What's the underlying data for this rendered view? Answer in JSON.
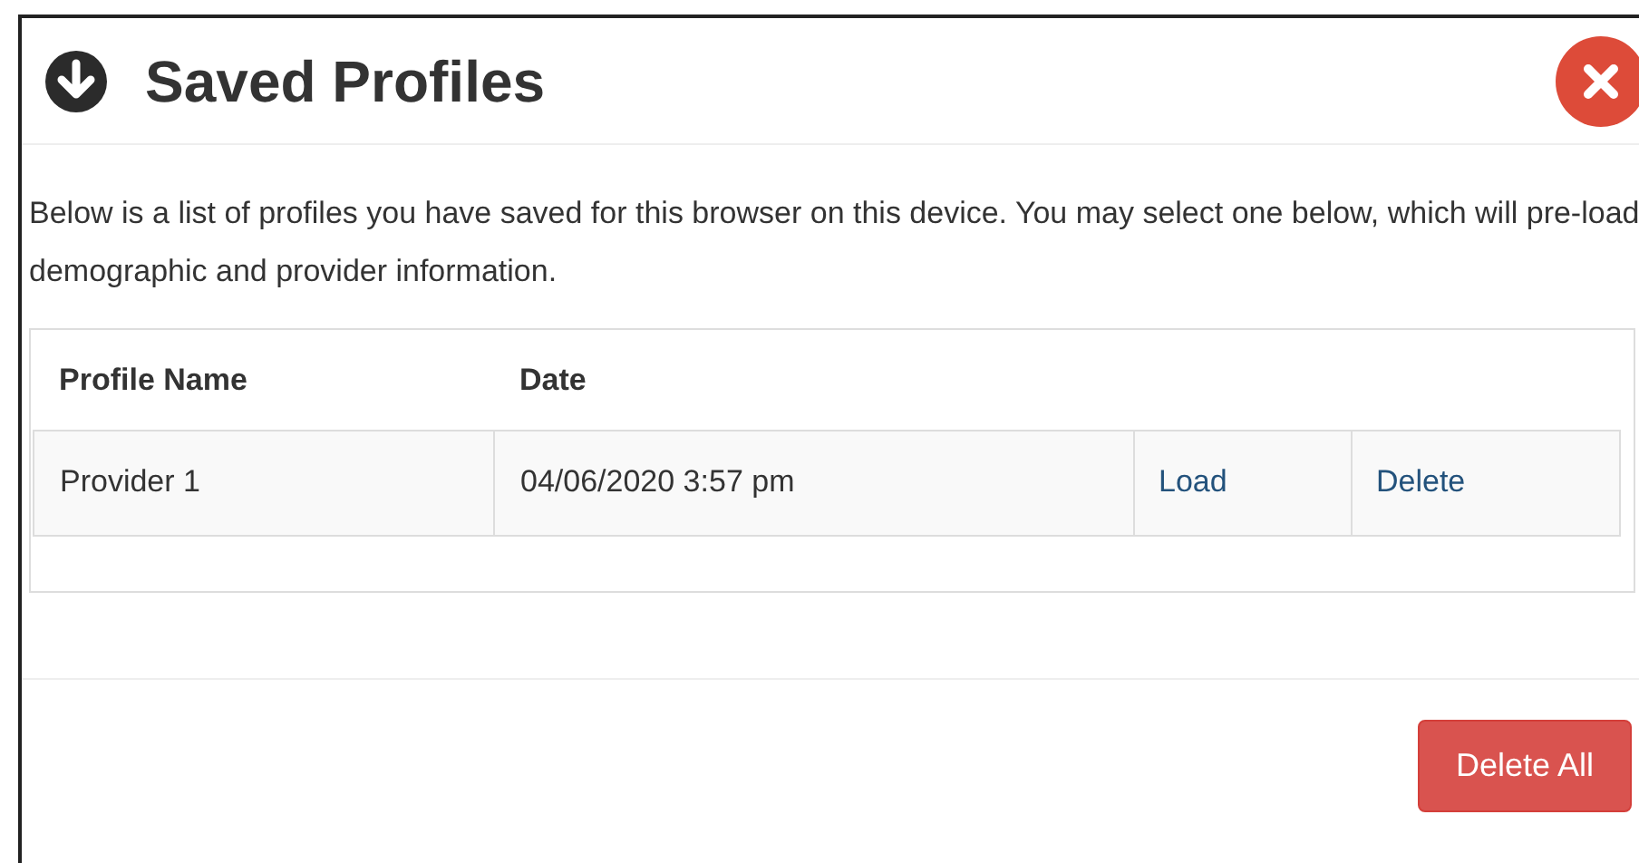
{
  "dialog": {
    "title": "Saved Profiles",
    "description": "Below is a list of profiles you have saved for this browser on this device. You may select one below, which will pre-load demographic and provider information.",
    "table": {
      "columns": [
        "Profile Name",
        "Date"
      ],
      "rows": [
        {
          "profile_name": "Provider 1",
          "date": "04/06/2020 3:57 pm",
          "actions": [
            "Load",
            "Delete"
          ]
        }
      ]
    },
    "buttons": [
      {
        "label": "Delete All",
        "kind": "danger"
      }
    ]
  }
}
